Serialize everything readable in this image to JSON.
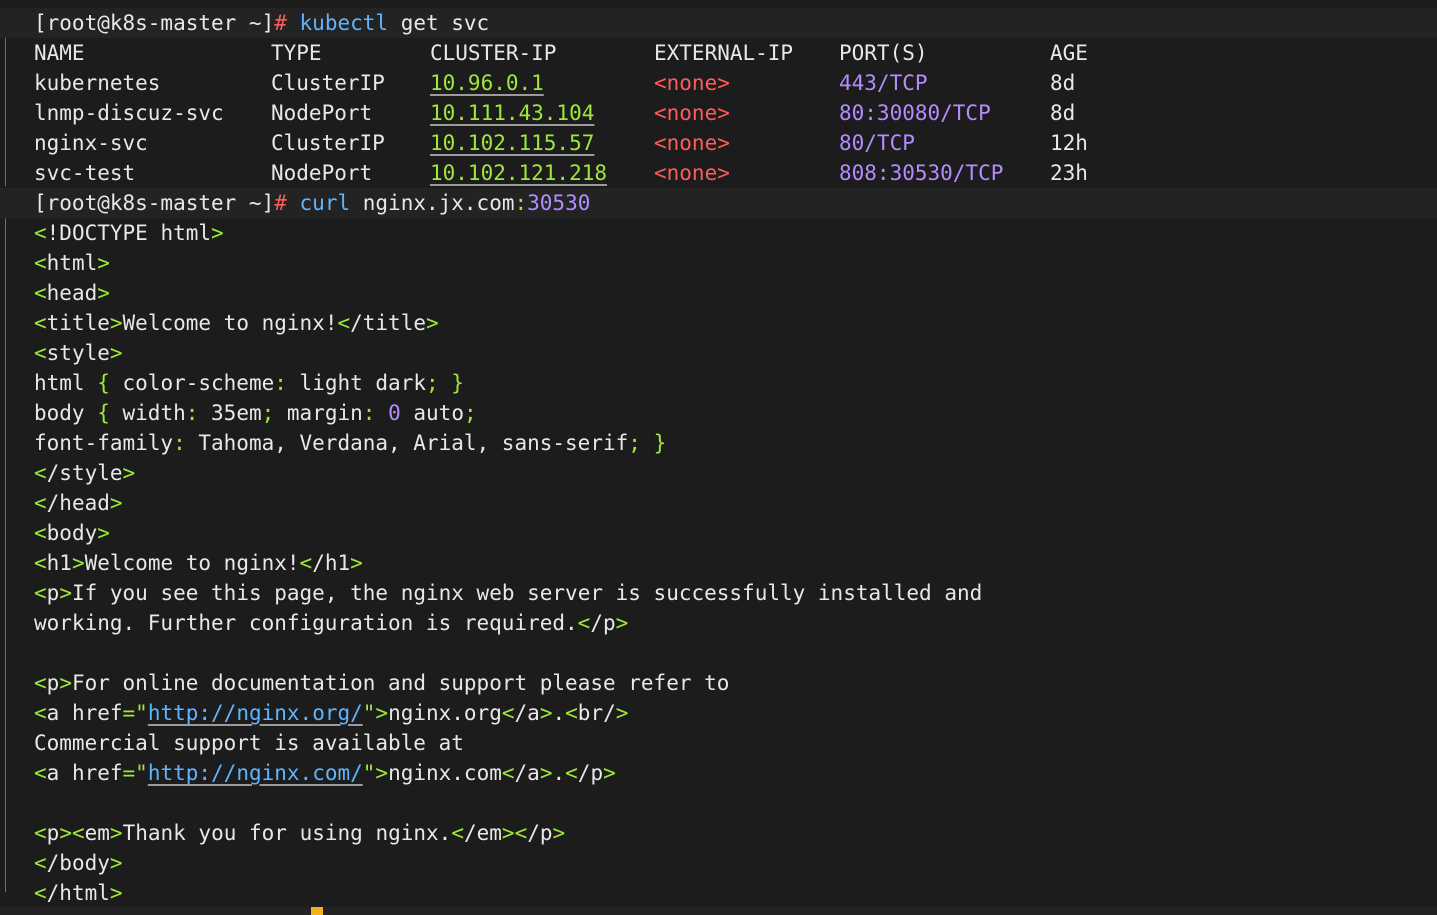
{
  "colors": {
    "background": "#1c1c1c",
    "foreground": "#e8e8e8",
    "prompt_symbol": "#ff5b5b",
    "punctuation": "#9ee83c",
    "command": "#5fb4ff",
    "number": "#b58cff",
    "cursor": "#f3b020"
  },
  "prompt1": {
    "user_host": "[root@k8s-master ~]",
    "symbol": "#",
    "command": "kubectl",
    "args": "get svc"
  },
  "svc_table": {
    "headers": [
      "NAME",
      "TYPE",
      "CLUSTER-IP",
      "EXTERNAL-IP",
      "PORT(S)",
      "AGE"
    ],
    "rows": [
      {
        "name": "kubernetes",
        "type": "ClusterIP",
        "cluster_ip": "10.96.0.1",
        "external_ip": "<none>",
        "ports": "443/TCP",
        "age": "8d"
      },
      {
        "name": "lnmp-discuz-svc",
        "type": "NodePort",
        "cluster_ip": "10.111.43.104",
        "external_ip": "<none>",
        "ports": "80:30080/TCP",
        "age": "8d"
      },
      {
        "name": "nginx-svc",
        "type": "ClusterIP",
        "cluster_ip": "10.102.115.57",
        "external_ip": "<none>",
        "ports": "80/TCP",
        "age": "12h"
      },
      {
        "name": "svc-test",
        "type": "NodePort",
        "cluster_ip": "10.102.121.218",
        "external_ip": "<none>",
        "ports": "808:30530/TCP",
        "age": "23h"
      }
    ]
  },
  "prompt2": {
    "user_host": "[root@k8s-master ~]",
    "symbol": "#",
    "command": "curl",
    "host": "nginx.jx.com",
    "port": "30530"
  },
  "html_output": [
    "<!DOCTYPE html>",
    "<html>",
    "<head>",
    "<title>Welcome to nginx!</title>",
    "<style>",
    "html { color-scheme: light dark; }",
    "body { width: 35em; margin: 0 auto;",
    "font-family: Tahoma, Verdana, Arial, sans-serif; }",
    "</style>",
    "</head>",
    "<body>",
    "<h1>Welcome to nginx!</h1>",
    "<p>If you see this page, the nginx web server is successfully installed and",
    "working. Further configuration is required.</p>",
    "",
    "<p>For online documentation and support please refer to",
    "<a href=\"http://nginx.org/\">nginx.org</a>.<br/>",
    "Commercial support is available at",
    "<a href=\"http://nginx.com/\">nginx.com</a>.</p>",
    "",
    "<p><em>Thank you for using nginx.</em></p>",
    "</body>",
    "</html>"
  ],
  "links": {
    "org": "http://nginx.org/",
    "com": "http://nginx.com/"
  }
}
